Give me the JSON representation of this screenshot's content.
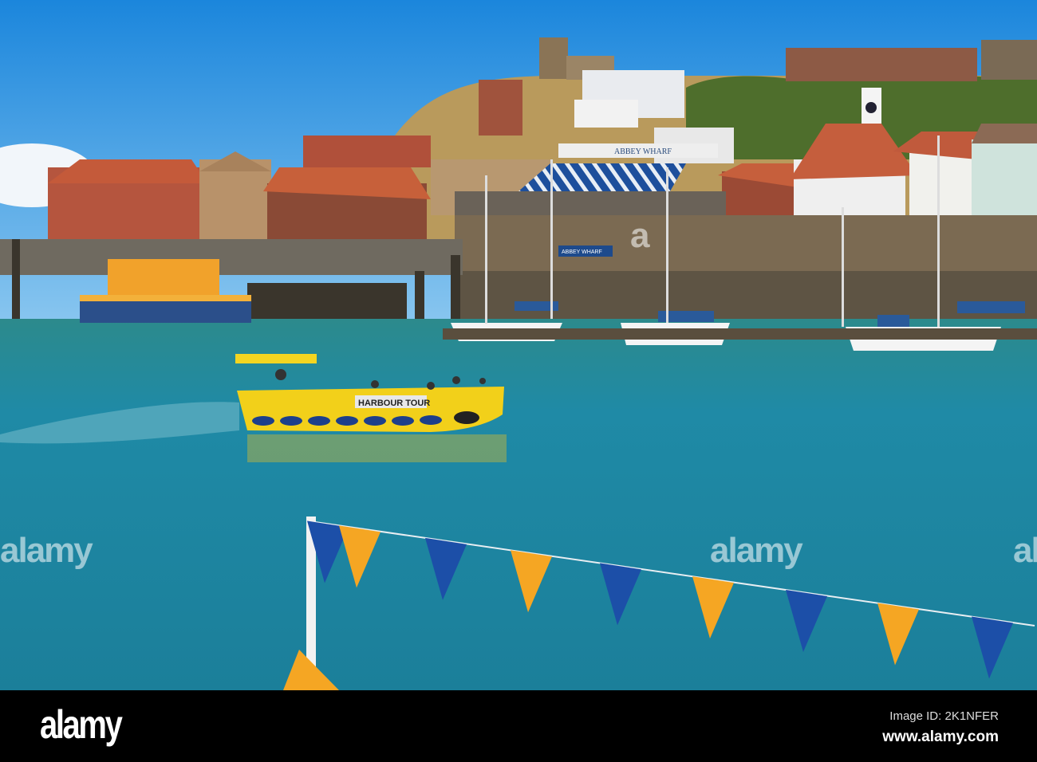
{
  "photo": {
    "boat_label": "HARBOUR TOUR",
    "sign_top": "ABBEY WHARF",
    "sign_wall": "ABBEY WHARF",
    "colors": {
      "sky_top": "#1b8be0",
      "sky_bottom": "#8fcaf2",
      "water": "#1f8aa0",
      "boat": "#f4d21a",
      "flag_orange": "#f5a623",
      "flag_blue": "#1c4fa8"
    }
  },
  "watermarks": [
    "alamy",
    "alamy",
    "alamy",
    "a"
  ],
  "footer": {
    "logo": "alamy",
    "image_id": "Image ID: 2K1NFER",
    "url": "www.alamy.com"
  }
}
